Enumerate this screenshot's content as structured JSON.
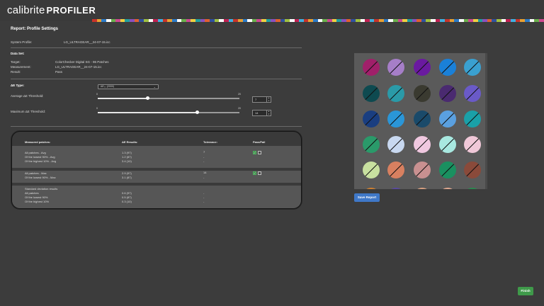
{
  "header": {
    "brand": "calibrite",
    "product": "PROFILER"
  },
  "strip_colors": [
    "#c8322a",
    "#e8a032",
    "#2a7ac8",
    "#ffffff",
    "#6ab04c",
    "#d04890",
    "#f0d040",
    "#20a0a0",
    "#8a50c0",
    "#e06030",
    "#3050a0",
    "#a0c040",
    "#ffffff",
    "#c02050",
    "#40b0e0"
  ],
  "page": {
    "title": "Report: Profile Settings",
    "system_profile_label": "System Profile:",
    "system_profile_value": "LG_ULTRAGEAR__24-07-15.icc",
    "dataset_heading": "Data Set:",
    "target_label": "Target:",
    "target_value": "ColorChecker Digital SG - 96 Patches",
    "measurement_label": "Measurement:",
    "measurement_value": "LG_ULTRAGEAR__24-07-15.icc",
    "result_label": "Result:",
    "result_value": "Pass"
  },
  "settings": {
    "de_type_label": "ΔE Type:",
    "de_type_value": "ΔE₀₀ (2000)",
    "avg_label": "Average ΔE Threshold:",
    "avg_min": "0",
    "avg_max": "20",
    "avg_value": "7",
    "avg_fraction": 0.35,
    "max_label": "Maximum ΔE Threshold:",
    "max_min": "0",
    "max_max": "20",
    "max_value": "14",
    "max_fraction": 0.7
  },
  "results": {
    "headers": {
      "measured": "Measured patches:",
      "de": "ΔE Results:",
      "tolerance": "Tolerance:",
      "passfail": "Pass/Fail"
    },
    "avg_group": {
      "rows": [
        "All patches - Avg",
        "Of the lowest 90% - Avg",
        "Of the highest 10% - Avg"
      ],
      "values": [
        "1.3 (97)",
        "1.2 (87)",
        "3.4 (10)"
      ],
      "tolerance": "7",
      "dashes": [
        "-",
        "-"
      ]
    },
    "max_group": {
      "rows": [
        "All patches - Max",
        "Of the lowest 90% - Max"
      ],
      "values": [
        "2.9 (97)",
        "3.1 (87)"
      ],
      "tolerance": "14",
      "dashes": [
        "-"
      ]
    },
    "std_group": {
      "rows": [
        "Standard deviation results",
        "All patches",
        "Of the lowest 90%",
        "Of the highest 10%"
      ],
      "values": [
        "0.6 (97)",
        "0.5 (87)",
        "0.3 (10)"
      ],
      "dashes": [
        "-",
        "-",
        "-"
      ]
    }
  },
  "patches": [
    [
      "#a0206a",
      "#a67ec8",
      "#6a1aa0",
      "#1a80d8",
      "#3aa0d0"
    ],
    [
      "#0e4a50",
      "#2a9aa8",
      "#3a3a30",
      "#4a2a70",
      "#6a5ac8"
    ],
    [
      "#1a3e80",
      "#2a96d8",
      "#1a4a6a",
      "#5aa0e0",
      "#1aa0a8"
    ],
    [
      "#2a9a6a",
      "#c8d8f0",
      "#f0c8e0",
      "#a8e8e0",
      "#f0c8d8"
    ],
    [
      "#c8e0a0",
      "#d88060",
      "#c89090",
      "#1a9060",
      "#8a4a3a"
    ],
    [
      "#d08030",
      "#5a4aa0",
      "#d8a080",
      "#e0a890",
      "#2a8a50"
    ]
  ],
  "buttons": {
    "save": "Save Report",
    "finish": "Finish"
  }
}
